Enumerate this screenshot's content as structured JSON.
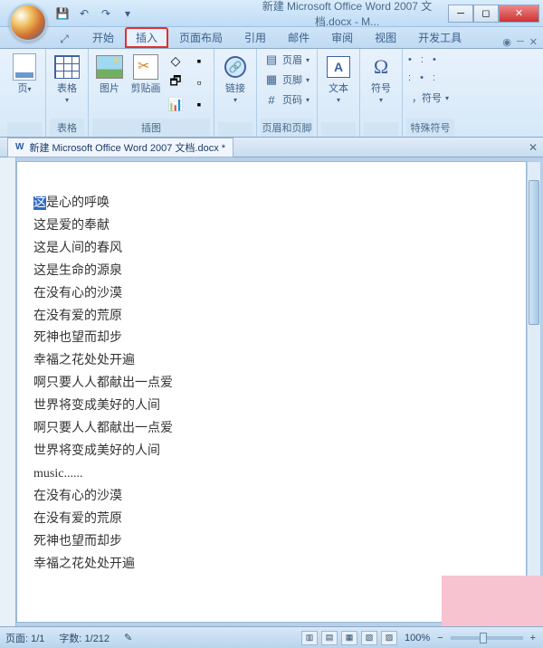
{
  "window": {
    "title": "新建 Microsoft Office Word 2007 文档.docx - M..."
  },
  "tabs": {
    "items": [
      "开始",
      "插入",
      "页面布局",
      "引用",
      "邮件",
      "审阅",
      "视图",
      "开发工具"
    ],
    "active_index": 1,
    "highlighted_index": 1
  },
  "ribbon": {
    "groups": {
      "page": {
        "label": "",
        "btn": "页"
      },
      "tables": {
        "label": "表格",
        "btn": "表格"
      },
      "illustrations": {
        "label": "插图",
        "picture": "图片",
        "clipart": "剪贴画"
      },
      "links": {
        "label": "",
        "btn": "链接"
      },
      "header_footer": {
        "label": "页眉和页脚",
        "header": "页眉",
        "footer": "页脚",
        "page_number": "页码"
      },
      "text": {
        "label": "",
        "btn": "文本"
      },
      "symbols": {
        "label": "",
        "btn": "符号"
      },
      "special": {
        "label": "特殊符号",
        "comma": "，符号"
      }
    }
  },
  "doc_tab": {
    "icon": "W",
    "name": "新建 Microsoft Office Word 2007 文档.docx *"
  },
  "document": {
    "lines": [
      "这是心的呼唤",
      "这是爱的奉献",
      "这是人间的春风",
      "这是生命的源泉",
      "在没有心的沙漠",
      "在没有爱的荒原",
      "死神也望而却步",
      "幸福之花处处开遍",
      "啊只要人人都献出一点爱",
      "世界将变成美好的人间",
      "啊只要人人都献出一点爱",
      "世界将变成美好的人间",
      "music......",
      "在没有心的沙漠",
      "在没有爱的荒原",
      "死神也望而却步",
      "幸福之花处处开遍"
    ]
  },
  "status": {
    "page": "页面: 1/1",
    "words": "字数: 1/212",
    "zoom": "100%"
  }
}
